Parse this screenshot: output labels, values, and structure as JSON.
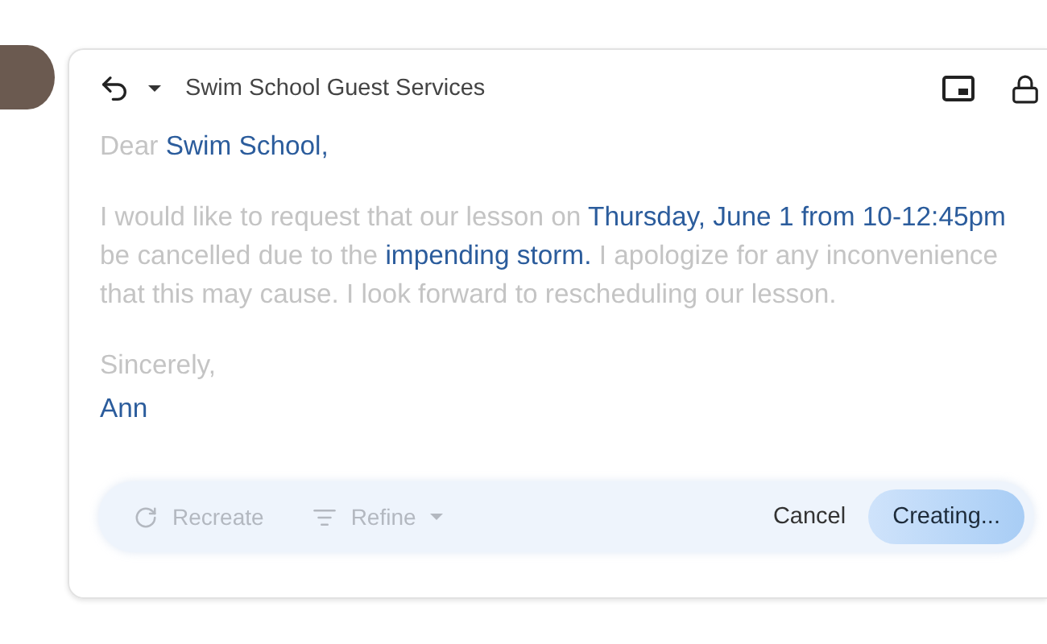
{
  "header": {
    "recipient": "Swim School Guest Services"
  },
  "body": [
    {
      "kind": "text",
      "segments": [
        {
          "text": "Dear ",
          "highlighted": false
        },
        {
          "text": "Swim School,",
          "highlighted": true
        }
      ]
    },
    {
      "kind": "text",
      "segments": [
        {
          "text": "I would like to request that our lesson on ",
          "highlighted": false
        },
        {
          "text": "Thursday, June 1 from 10-12:45pm",
          "highlighted": true
        },
        {
          "text": " be cancelled due to the ",
          "highlighted": false
        },
        {
          "text": "impending storm.",
          "highlighted": true
        },
        {
          "text": " I apologize for any inconvenience that this may cause. I look forward to rescheduling our lesson.",
          "highlighted": false
        }
      ]
    },
    {
      "kind": "signature",
      "segments": [
        {
          "text": "Sincerely,",
          "highlighted": false
        }
      ]
    },
    {
      "kind": "signature",
      "segments": [
        {
          "text": "Ann",
          "highlighted": true
        }
      ]
    }
  ],
  "toolbar": {
    "recreate": {
      "label": "Recreate",
      "disabled": true
    },
    "refine": {
      "label": "Refine",
      "disabled": true
    },
    "cancel": "Cancel",
    "primary": "Creating..."
  }
}
